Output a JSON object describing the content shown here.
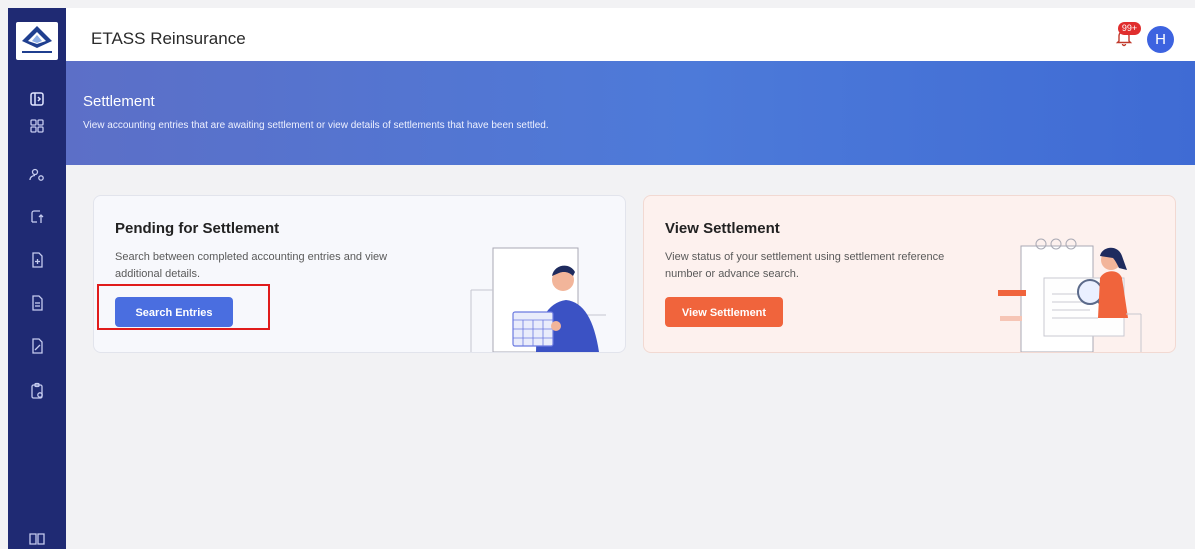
{
  "header": {
    "title": "ETASS Reinsurance",
    "notifications_badge": "99+",
    "avatar_letter": "H"
  },
  "banner": {
    "title": "Settlement",
    "subtitle": "View accounting entries that are awaiting settlement or view details of settlements that have been settled."
  },
  "cards": {
    "pending": {
      "title": "Pending for Settlement",
      "description": "Search between completed accounting entries and view additional details.",
      "button_label": "Search Entries"
    },
    "view": {
      "title": "View Settlement",
      "description": "View status of your settlement using settlement reference number or advance search.",
      "button_label": "View Settlement"
    }
  },
  "colors": {
    "sidebar": "#1f2a73",
    "banner_start": "#5c6fc7",
    "banner_end": "#3f6bd4",
    "primary_button": "#4a6ee0",
    "accent_button": "#f0643c",
    "highlight_box": "#e01b1b"
  },
  "sidebar": {
    "items": [
      {
        "icon": "panel-toggle-icon"
      },
      {
        "icon": "dashboard-grid-icon"
      },
      {
        "icon": "users-settings-icon"
      },
      {
        "icon": "export-icon"
      },
      {
        "icon": "document-add-icon"
      },
      {
        "icon": "document-list-icon"
      },
      {
        "icon": "document-edit-icon"
      },
      {
        "icon": "clipboard-settings-icon"
      },
      {
        "icon": "book-icon"
      }
    ]
  }
}
